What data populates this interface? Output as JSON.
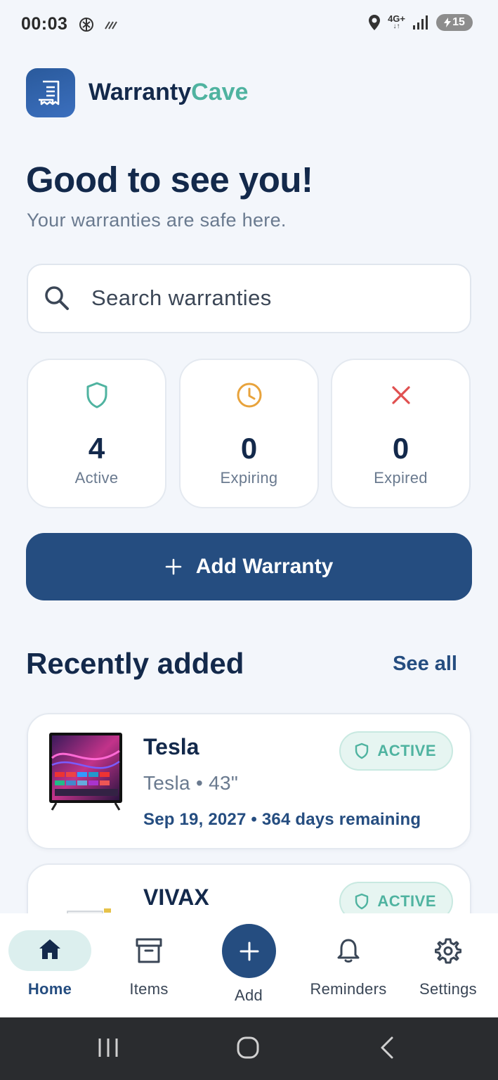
{
  "status_bar": {
    "time": "00:03",
    "network": "4G+",
    "battery": "15"
  },
  "header": {
    "app_name_part1": "Warranty",
    "app_name_part2": "Cave",
    "logo_icon": "receipt-icon"
  },
  "greeting": {
    "title": "Good to see you!",
    "subtitle": "Your warranties are safe here."
  },
  "search": {
    "placeholder": "Search warranties"
  },
  "stats": [
    {
      "value": "4",
      "label": "Active",
      "icon": "shield-icon",
      "color": "#4fb3a0"
    },
    {
      "value": "0",
      "label": "Expiring",
      "icon": "clock-icon",
      "color": "#e8a33c"
    },
    {
      "value": "0",
      "label": "Expired",
      "icon": "close-icon",
      "color": "#e05050"
    }
  ],
  "add_button": {
    "label": "Add Warranty"
  },
  "recent": {
    "title": "Recently added",
    "see_all": "See all",
    "items": [
      {
        "name": "Tesla",
        "sub": "Tesla • 43\"",
        "date": "Sep 19, 2027 • 364 days remaining",
        "status": "ACTIVE"
      },
      {
        "name": "VIVAX",
        "status": "ACTIVE"
      }
    ]
  },
  "nav": {
    "items": [
      {
        "label": "Home",
        "icon": "home-icon"
      },
      {
        "label": "Items",
        "icon": "archive-icon"
      },
      {
        "label": "Add",
        "icon": "plus-icon"
      },
      {
        "label": "Reminders",
        "icon": "bell-icon"
      },
      {
        "label": "Settings",
        "icon": "gear-icon"
      }
    ]
  },
  "colors": {
    "primary": "#254d80",
    "accent": "#4fb3a0",
    "background": "#f3f6fb",
    "text": "#13294b"
  }
}
